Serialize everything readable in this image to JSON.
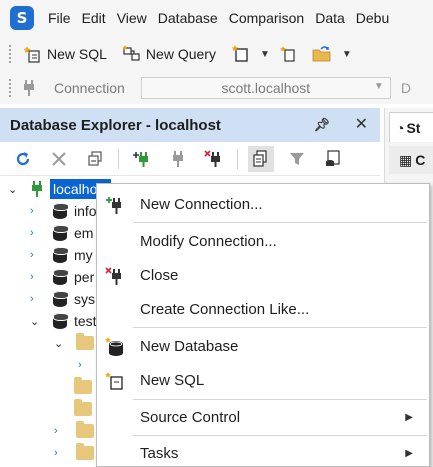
{
  "menubar": {
    "logo_letter": "S",
    "items": [
      "File",
      "Edit",
      "View",
      "Database",
      "Comparison",
      "Data",
      "Debu"
    ]
  },
  "toolbar1": {
    "new_sql_label": "New SQL",
    "new_query_label": "New Query"
  },
  "toolbar2": {
    "connection_label": "Connection",
    "connection_value": "scott.localhost",
    "trail": "D"
  },
  "explorer": {
    "title": "Database Explorer - localhost",
    "tree": {
      "root": "localhost",
      "databases": [
        "info",
        "em",
        "my",
        "per",
        "sys",
        "test"
      ]
    }
  },
  "right_panel": {
    "tab1_label": "St",
    "tab2_label": "C"
  },
  "context_menu": {
    "items": [
      {
        "label": "New Connection...",
        "icon": "new-connection-icon"
      },
      {
        "label": "Modify Connection...",
        "icon": ""
      },
      {
        "label": "Close",
        "icon": "close-connection-icon"
      },
      {
        "label": "Create Connection Like...",
        "icon": ""
      },
      {
        "label": "New Database",
        "icon": "new-database-icon"
      },
      {
        "label": "New SQL",
        "icon": "new-sql-icon"
      },
      {
        "label": "Source Control",
        "icon": ""
      },
      {
        "label": "Tasks",
        "icon": ""
      }
    ]
  },
  "colors": {
    "accent": "#0a64d2",
    "panel_header": "#cfe0f4",
    "plug_green": "#2e9a3a"
  }
}
